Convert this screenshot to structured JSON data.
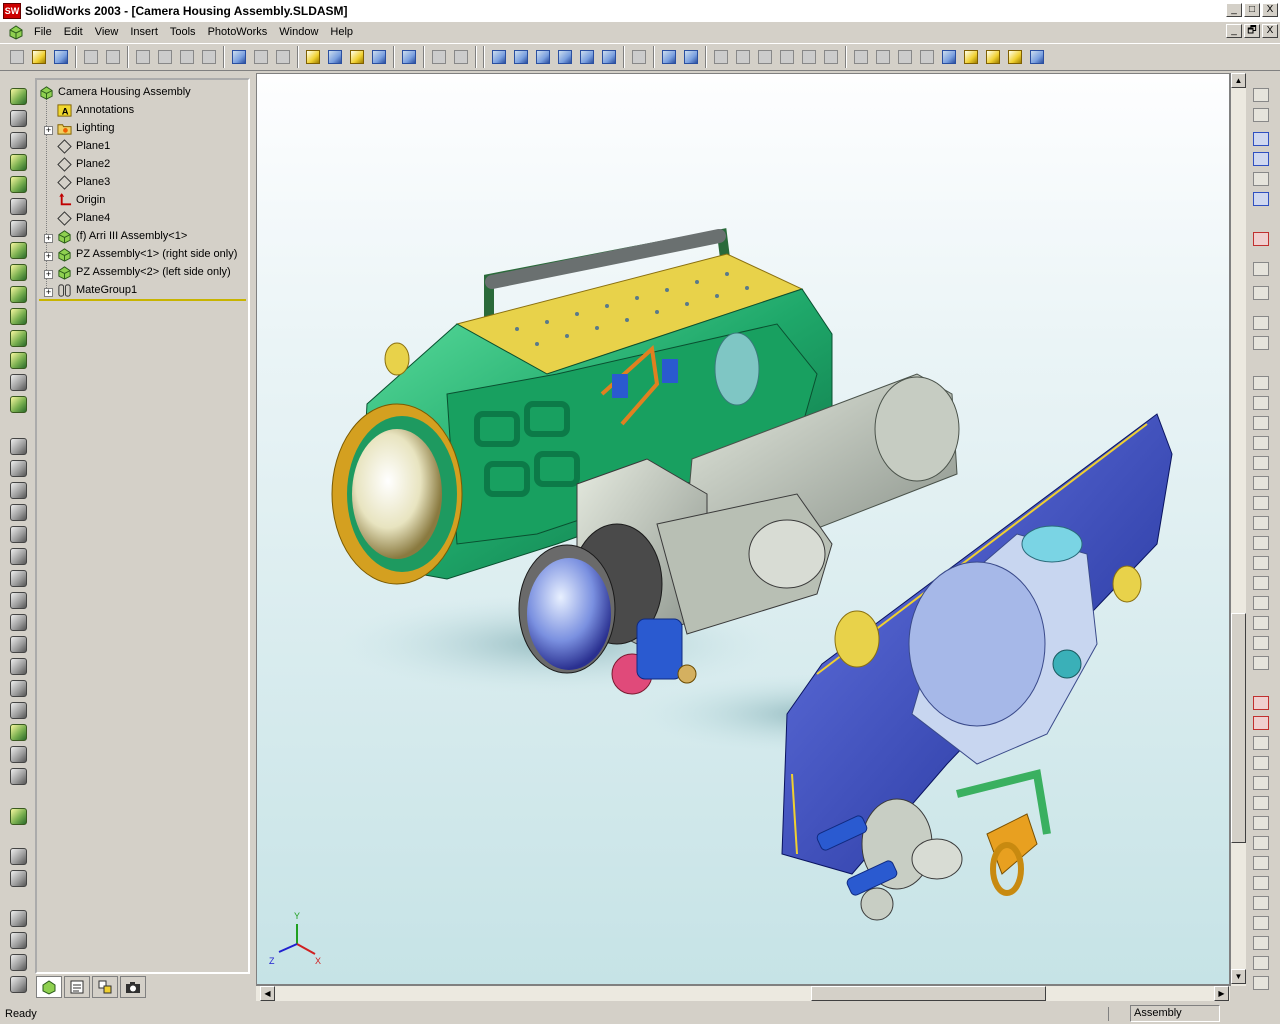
{
  "window": {
    "title": "SolidWorks 2003 - [Camera Housing Assembly.SLDASM]",
    "app_badge": "SW",
    "minimize": "_",
    "maximize": "□",
    "close": "X",
    "restore": "🗗"
  },
  "menu": {
    "items": [
      "File",
      "Edit",
      "View",
      "Insert",
      "Tools",
      "PhotoWorks",
      "Window",
      "Help"
    ]
  },
  "tree": {
    "root": "Camera Housing Assembly",
    "items": [
      {
        "label": "Annotations",
        "icon": "annotations-icon"
      },
      {
        "label": "Lighting",
        "icon": "lighting-folder-icon"
      },
      {
        "label": "Plane1",
        "icon": "plane-icon"
      },
      {
        "label": "Plane2",
        "icon": "plane-icon"
      },
      {
        "label": "Plane3",
        "icon": "plane-icon"
      },
      {
        "label": "Origin",
        "icon": "origin-icon"
      },
      {
        "label": "Plane4",
        "icon": "plane-icon"
      },
      {
        "label": "(f) Arri III Assembly<1>",
        "icon": "assembly-icon"
      },
      {
        "label": "PZ Assembly<1> (right side only)",
        "icon": "assembly-icon"
      },
      {
        "label": "PZ Assembly<2> (left side only)",
        "icon": "assembly-icon"
      },
      {
        "label": "MateGroup1",
        "icon": "mates-icon"
      }
    ]
  },
  "status": {
    "left": "Ready",
    "mode": "Assembly"
  },
  "triad": {
    "x": "X",
    "y": "Y",
    "z": "Z"
  },
  "colors": {
    "housing_green": "#1fa86a",
    "housing_yellow": "#e8d24a",
    "plate_blue": "#2a3fb8",
    "camera_grey": "#b8bfb4"
  }
}
